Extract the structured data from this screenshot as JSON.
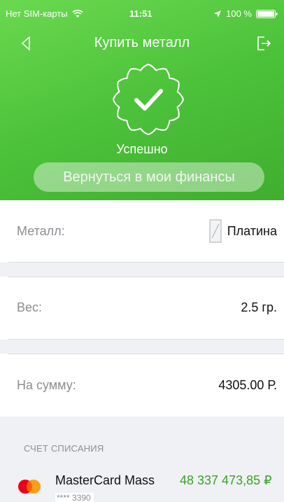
{
  "status_bar": {
    "carrier": "Нет SIM-карты",
    "time": "11:51",
    "battery": "100 %"
  },
  "nav": {
    "title": "Купить металл"
  },
  "result": {
    "status": "Успешно",
    "return_button": "Вернуться в мои финансы"
  },
  "details": {
    "metal_label": "Металл:",
    "metal_value": "Платина",
    "weight_label": "Вес:",
    "weight_value": "2.5 гр.",
    "sum_label": "На сумму:",
    "sum_value": "4305.00 Р."
  },
  "debit_account": {
    "section_label": "СЧЕТ СПИСАНИЯ",
    "card_name": "MasterCard Mass",
    "card_amount": "48 337 473,85 ₽",
    "card_number": "**** 3390"
  },
  "icons": [
    "wifi-icon",
    "location-arrow-icon",
    "battery-icon",
    "back-arrow-icon",
    "exit-icon",
    "success-badge-icon",
    "ingot-icon",
    "mastercard-icon"
  ],
  "colors": {
    "header_green": "#4cc23a",
    "amount_green": "#3ba12a",
    "section_bg": "#eff1f4",
    "label_gray": "#8e8e93"
  }
}
